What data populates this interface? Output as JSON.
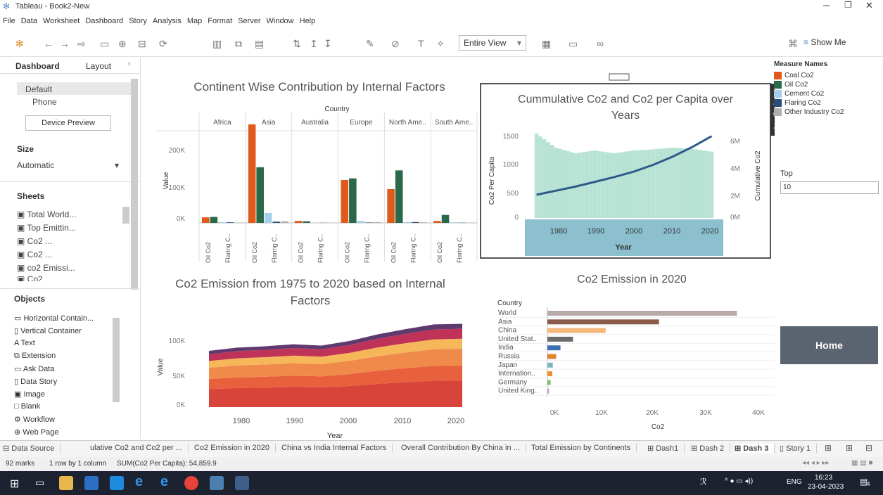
{
  "window": {
    "title": "Tableau - Book2-New"
  },
  "menu": [
    "File",
    "Data",
    "Worksheet",
    "Dashboard",
    "Story",
    "Analysis",
    "Map",
    "Format",
    "Server",
    "Window",
    "Help"
  ],
  "toolbar": {
    "fit": "Entire View",
    "show_me": "Show Me"
  },
  "left_panel": {
    "tabs": [
      "Dashboard",
      "Layout"
    ],
    "devices": [
      "Default",
      "Phone"
    ],
    "device_preview": "Device Preview",
    "size_label": "Size",
    "size_value": "Automatic",
    "sheets_label": "Sheets",
    "sheets": [
      "Total World...",
      "Top Emittin...",
      "Co2 ...",
      "Co2 ...",
      "co2 Emissi...",
      "Co2"
    ],
    "objects_label": "Objects",
    "objects": [
      "Horizontal Contain...",
      "Vertical Container",
      "Text",
      "Extension",
      "Ask Data",
      "Data Story",
      "Image",
      "Blank",
      "Workflow",
      "Web Page"
    ]
  },
  "charts": {
    "continent": {
      "title": "Continent Wise Contribution by Internal Factors",
      "header": "Country",
      "ylabel": "Value",
      "yticks": [
        "200K",
        "100K",
        "0K"
      ]
    },
    "cumulative": {
      "title_l1": "Cummulative Co2 and Co2 per Capita over",
      "title_l2": "Years",
      "ylabel_left": "Co2 Per Capita",
      "ylabel_right": "Cumulative Co2",
      "xlabel": "Year",
      "yticks_left": [
        "1500",
        "1000",
        "500",
        "0"
      ],
      "yticks_right": [
        "6M",
        "4M",
        "2M",
        "0M"
      ],
      "xticks": [
        "1980",
        "1990",
        "2000",
        "2010",
        "2020"
      ]
    },
    "emission": {
      "title_l1": "Co2 Emission from 1975 to 2020 based on Internal",
      "title_l2": "Factors",
      "ylabel": "Value",
      "xlabel": "Year",
      "yticks": [
        "100K",
        "50K",
        "0K"
      ],
      "xticks": [
        "1980",
        "1990",
        "2000",
        "2010",
        "2020"
      ]
    },
    "emission2020": {
      "title": "Co2 Emission in 2020",
      "header": "Country",
      "xlabel": "Co2",
      "xticks": [
        "0K",
        "10K",
        "20K",
        "30K",
        "40K"
      ]
    }
  },
  "chart_data": [
    {
      "type": "bar",
      "title": "Continent Wise Contribution by Internal Factors",
      "xlabel": "",
      "ylabel": "Value",
      "ylim": [
        0,
        260000
      ],
      "categories": [
        "Africa",
        "Asia",
        "Australia",
        "Europe",
        "North Ame..",
        "South Ame.."
      ],
      "series": [
        {
          "name": "Coal Co2",
          "color": "#e05a1b",
          "values": [
            14000,
            248000,
            5000,
            108000,
            85000,
            5000
          ]
        },
        {
          "name": "Oil Co2",
          "color": "#2b6a48",
          "values": [
            15000,
            140000,
            4000,
            112000,
            132000,
            20000
          ]
        },
        {
          "name": "Cement Co2",
          "color": "#a6cfe8",
          "values": [
            2000,
            25000,
            500,
            5000,
            2000,
            1500
          ]
        },
        {
          "name": "Flaring Co2",
          "color": "#2a4d7a",
          "values": [
            1500,
            3000,
            300,
            1000,
            2000,
            500
          ]
        },
        {
          "name": "Other Industry Co2",
          "color": "#b0b0b0",
          "values": [
            500,
            4000,
            200,
            2000,
            1500,
            300
          ]
        }
      ],
      "xticks": [
        "Oil Co2",
        "Flaring C.."
      ]
    },
    {
      "type": "line",
      "title": "Cummulative Co2 and Co2 per Capita over Years",
      "xlabel": "Year",
      "ylabel": "Co2 Per Capita",
      "x": [
        1975,
        1980,
        1985,
        1990,
        1995,
        2000,
        2005,
        2010,
        2015,
        2020
      ],
      "series": [
        {
          "name": "Cumulative Co2",
          "values": [
            1700000,
            2000000,
            2300000,
            2650000,
            3000000,
            3400000,
            3900000,
            4500000,
            5200000,
            6000000
          ]
        },
        {
          "name": "Co2 Per Capita",
          "values": [
            1500,
            1250,
            1150,
            1200,
            1150,
            1200,
            1220,
            1250,
            1230,
            1180
          ]
        }
      ],
      "ylim": [
        0,
        1600
      ],
      "ylim_right": [
        0,
        6600000
      ]
    },
    {
      "type": "area",
      "title": "Co2 Emission from 1975 to 2020 based on Internal Factors",
      "xlabel": "Year",
      "ylabel": "Value",
      "ylim": [
        0,
        135000
      ],
      "x": [
        1975,
        1980,
        1985,
        1990,
        1995,
        2000,
        2005,
        2010,
        2015,
        2020
      ],
      "values": [
        85000,
        90000,
        92000,
        95000,
        93000,
        100000,
        110000,
        118000,
        125000,
        126000
      ]
    },
    {
      "type": "bar",
      "title": "Co2 Emission in 2020",
      "xlabel": "Co2",
      "ylabel": "Country",
      "xlim": [
        0,
        42000
      ],
      "categories": [
        "World",
        "Asia",
        "China",
        "United Stat..",
        "India",
        "Russia",
        "Japan",
        "Internation..",
        "Germany",
        "United King.."
      ],
      "values": [
        34800,
        20500,
        10700,
        4700,
        2400,
        1600,
        1000,
        900,
        600,
        300
      ],
      "colors": [
        "#b8aaa6",
        "#8a5a4a",
        "#f5b87a",
        "#6b6b6b",
        "#3a6fb0",
        "#e2832f",
        "#7ab5c0",
        "#e8932a",
        "#7fc26b",
        "#c7a6c4"
      ]
    }
  ],
  "legend": {
    "title": "Measure Names",
    "items": [
      {
        "label": "Coal Co2",
        "color": "#e05a1b"
      },
      {
        "label": "Oil Co2",
        "color": "#2b6a48"
      },
      {
        "label": "Cement Co2",
        "color": "#a6cfe8"
      },
      {
        "label": "Flaring Co2",
        "color": "#2a4d7a"
      },
      {
        "label": "Other Industry Co2",
        "color": "#b0b0b0"
      }
    ]
  },
  "top_filter": {
    "label": "Top",
    "value": "10"
  },
  "home_button": "Home",
  "bottom_tabs": [
    "Data Source",
    "ulative Co2 and Co2 per ...",
    "Co2 Emission in 2020",
    "China vs India Internal Factors",
    "Overall Contribution By China in ...",
    "Total Emission by Continents",
    "Dash1",
    "Dash 2",
    "Dash 3",
    "Story 1"
  ],
  "status": {
    "marks": "92 marks",
    "rows": "1 row by 1 column",
    "sum": "SUM(Co2 Per Capita): 54,859.9"
  },
  "taskbar": {
    "lang": "ENG",
    "time": "16:23",
    "date": "23-04-2023",
    "notif": "4"
  }
}
